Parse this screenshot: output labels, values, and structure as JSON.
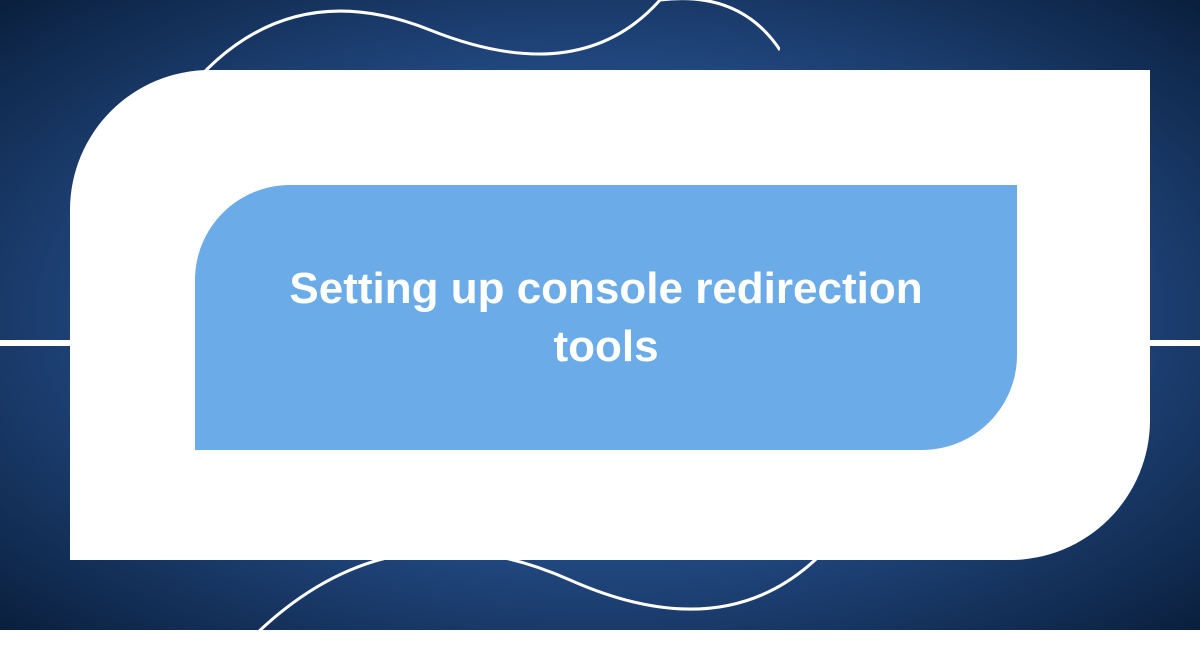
{
  "title": "Setting up console redirection tools",
  "colors": {
    "background_inner": "#5a8fd4",
    "background_outer": "#0a1f3d",
    "shape_outer": "#ffffff",
    "shape_inner": "#6aabe8",
    "text": "#ffffff"
  }
}
